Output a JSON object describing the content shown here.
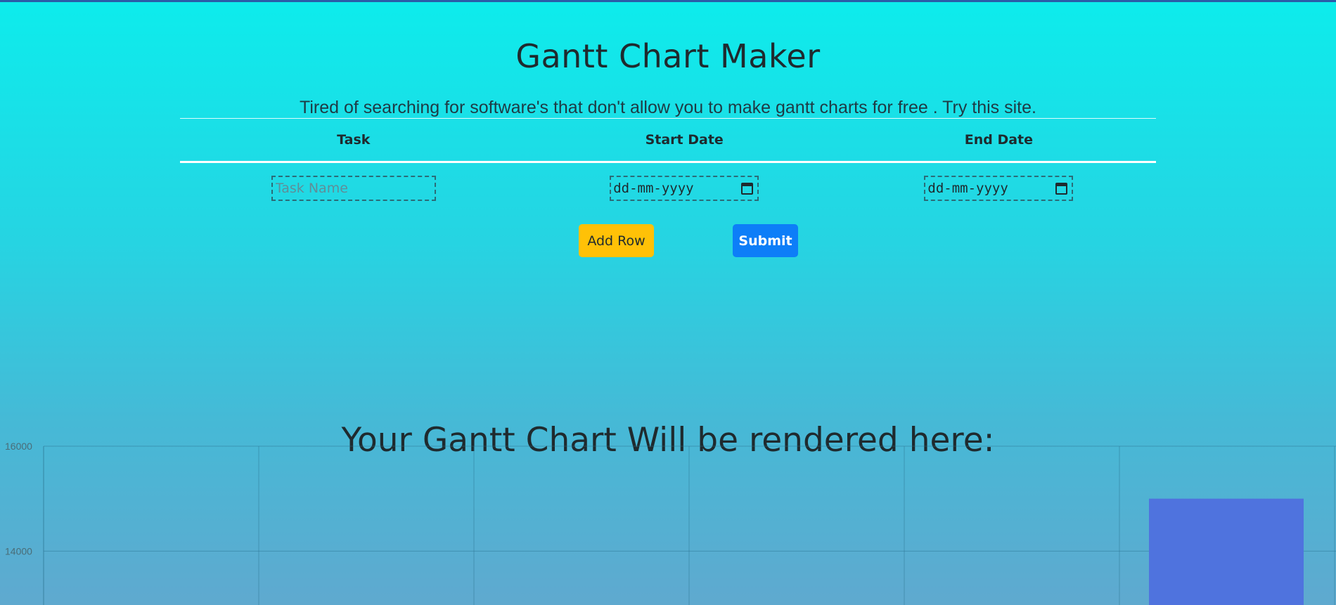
{
  "header": {
    "title": "Gantt Chart Maker",
    "subtitle": "Tired of searching for software's that don't allow you to make gantt charts for free . Try this site."
  },
  "form": {
    "columns": [
      "Task",
      "Start Date",
      "End Date"
    ],
    "task_placeholder": "Task Name",
    "start_date_placeholder": "dd-mm-yyyy",
    "end_date_placeholder": "dd-mm-yyyy"
  },
  "buttons": {
    "add_row": "Add Row",
    "submit": "Submit"
  },
  "chart_section": {
    "heading": "Your Gantt Chart Will be rendered here:"
  },
  "icons": {
    "date_picker": "calendar-icon"
  },
  "colors": {
    "add_row_button": "#ffc107",
    "submit_button": "#0d7ef8",
    "bar": "#4f73de"
  },
  "chart_data": {
    "type": "bar",
    "y_ticks": [
      "16000",
      "14000"
    ],
    "ylim_visible": [
      12973,
      16000
    ],
    "category_count": 6,
    "values": [
      null,
      null,
      null,
      null,
      null,
      15000
    ],
    "grid": true
  }
}
